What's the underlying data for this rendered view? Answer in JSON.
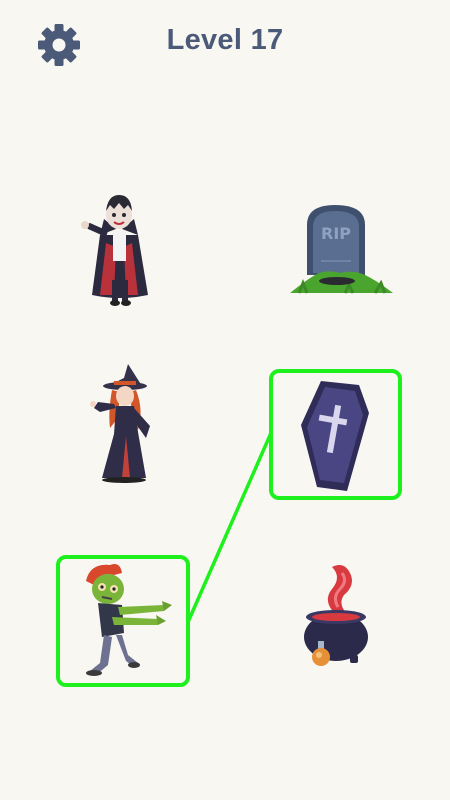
{
  "header": {
    "settings_icon": "gear-icon",
    "level_label": "Level 17"
  },
  "board": {
    "items": [
      {
        "id": "vampire",
        "icon": "vampire-figure",
        "column": "left",
        "row": 1,
        "selected": false
      },
      {
        "id": "tombstone",
        "icon": "rip-tombstone",
        "column": "right",
        "row": 1,
        "selected": false
      },
      {
        "id": "witch",
        "icon": "witch-figure",
        "column": "left",
        "row": 2,
        "selected": false
      },
      {
        "id": "coffin",
        "icon": "coffin",
        "column": "right",
        "row": 2,
        "selected": true
      },
      {
        "id": "zombie",
        "icon": "zombie-figure",
        "column": "left",
        "row": 3,
        "selected": true
      },
      {
        "id": "cauldron",
        "icon": "potion-cauldron",
        "column": "right",
        "row": 3,
        "selected": false
      }
    ],
    "tombstone_text": "RIP",
    "connection": {
      "from": "zombie",
      "to": "coffin"
    },
    "colors": {
      "background": "#f8f7f2",
      "title": "#4a5a78",
      "selection": "#1df01d"
    }
  }
}
